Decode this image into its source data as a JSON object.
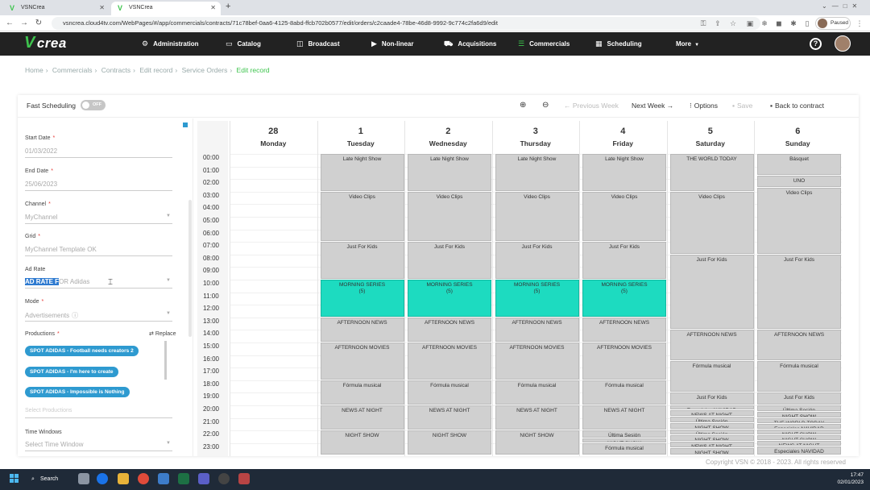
{
  "browser": {
    "tabs": [
      {
        "title": "VSNCrea"
      },
      {
        "title": "VSNCrea"
      }
    ],
    "url": "vsncrea.cloud4tv.com/WebPages/#/app/commercials/contracts/71c78bef-0aa6-4125-8abd-ffcb702b0577/edit/orders/c2caade4-78be-46d8-9992-9c774c2fa6d9/edit",
    "profile_status": "Paused"
  },
  "app": {
    "logo": "crea",
    "nav": [
      {
        "label": "Administration",
        "icon": "gear-icon"
      },
      {
        "label": "Catalog",
        "icon": "folder-icon"
      },
      {
        "label": "Broadcast",
        "icon": "broadcast-icon"
      },
      {
        "label": "Non-linear",
        "icon": "play-icon"
      },
      {
        "label": "Acquisitions",
        "icon": "basket-icon"
      },
      {
        "label": "Commercials",
        "icon": "list-icon"
      },
      {
        "label": "Scheduling",
        "icon": "calendar-icon"
      },
      {
        "label": "More",
        "icon": "caret-down-icon"
      }
    ],
    "active_nav": "Commercials",
    "accent_color": "#3ec44e"
  },
  "breadcrumb": [
    "Home",
    "Commercials",
    "Contracts",
    "Edit record",
    "Service Orders",
    "Edit record"
  ],
  "toolbar": {
    "fast_scheduling_label": "Fast Scheduling",
    "fast_scheduling_state": "OFF",
    "previous_week": "← Previous Week",
    "next_week": "Next Week →",
    "options": "Options",
    "save": "Save",
    "back": "Back to contract"
  },
  "form": {
    "start_date": {
      "label": "Start Date",
      "value": "01/03/2022"
    },
    "end_date": {
      "label": "End Date",
      "value": "25/06/2023"
    },
    "channel": {
      "label": "Channel",
      "value": "MyChannel"
    },
    "grid": {
      "label": "Grid",
      "value": "MyChannel Template OK"
    },
    "ad_rate": {
      "label": "Ad Rate",
      "value_selected": "AD RATE F",
      "value_rest": "OR Adidas"
    },
    "mode": {
      "label": "Mode",
      "value": "Advertisements"
    },
    "productions": {
      "label": "Productions",
      "replace_label": "Replace",
      "items": [
        "SPOT ADIDAS - Football needs creators 2",
        "SPOT ADIDAS - I'm here to create",
        "SPOT ADIDAS - Impossible is Nothing"
      ],
      "placeholder": "Select Productions"
    },
    "time_windows": {
      "label": "Time Windows",
      "placeholder": "Select Time Window"
    }
  },
  "schedule": {
    "hours": [
      "00:00",
      "01:00",
      "02:00",
      "03:00",
      "04:00",
      "05:00",
      "06:00",
      "07:00",
      "08:00",
      "09:00",
      "10:00",
      "11:00",
      "12:00",
      "13:00",
      "14:00",
      "15:00",
      "16:00",
      "17:00",
      "18:00",
      "19:00",
      "20:00",
      "21:00",
      "22:00",
      "23:00"
    ],
    "days": [
      {
        "num": "28",
        "name": "Monday",
        "blocks": []
      },
      {
        "num": "1",
        "name": "Tuesday",
        "blocks": [
          {
            "label": "Late Night Show",
            "start": 0,
            "end": 3
          },
          {
            "label": "Video Clips",
            "start": 3,
            "end": 7
          },
          {
            "label": "Just For Kids",
            "start": 7,
            "end": 10
          },
          {
            "label": "MORNING SERIES",
            "sub": "(5)",
            "start": 10,
            "end": 13,
            "teal": true
          },
          {
            "label": "AFTERNOON NEWS",
            "start": 13,
            "end": 15
          },
          {
            "label": "AFTERNOON MOVIES",
            "start": 15,
            "end": 18
          },
          {
            "label": "Fórmula musical",
            "start": 18,
            "end": 20
          },
          {
            "label": "NEWS AT NIGHT",
            "start": 20,
            "end": 22
          },
          {
            "label": "NIGHT SHOW",
            "start": 22,
            "end": 24
          }
        ]
      },
      {
        "num": "2",
        "name": "Wednesday",
        "blocks": [
          {
            "label": "Late Night Show",
            "start": 0,
            "end": 3
          },
          {
            "label": "Video Clips",
            "start": 3,
            "end": 7
          },
          {
            "label": "Just For Kids",
            "start": 7,
            "end": 10
          },
          {
            "label": "MORNING SERIES",
            "sub": "(5)",
            "start": 10,
            "end": 13,
            "teal": true
          },
          {
            "label": "AFTERNOON NEWS",
            "start": 13,
            "end": 15
          },
          {
            "label": "AFTERNOON MOVIES",
            "start": 15,
            "end": 18
          },
          {
            "label": "Fórmula musical",
            "start": 18,
            "end": 20
          },
          {
            "label": "NEWS AT NIGHT",
            "start": 20,
            "end": 22
          },
          {
            "label": "NIGHT SHOW",
            "start": 22,
            "end": 24
          }
        ]
      },
      {
        "num": "3",
        "name": "Thursday",
        "blocks": [
          {
            "label": "Late Night Show",
            "start": 0,
            "end": 3
          },
          {
            "label": "Video Clips",
            "start": 3,
            "end": 7
          },
          {
            "label": "Just For Kids",
            "start": 7,
            "end": 10
          },
          {
            "label": "MORNING SERIES",
            "sub": "(5)",
            "start": 10,
            "end": 13,
            "teal": true
          },
          {
            "label": "AFTERNOON NEWS",
            "start": 13,
            "end": 15
          },
          {
            "label": "AFTERNOON MOVIES",
            "start": 15,
            "end": 18
          },
          {
            "label": "Fórmula musical",
            "start": 18,
            "end": 20
          },
          {
            "label": "NEWS AT NIGHT",
            "start": 20,
            "end": 22
          },
          {
            "label": "NIGHT SHOW",
            "start": 22,
            "end": 24
          }
        ]
      },
      {
        "num": "4",
        "name": "Friday",
        "blocks": [
          {
            "label": "Late Night Show",
            "start": 0,
            "end": 3
          },
          {
            "label": "Video Clips",
            "start": 3,
            "end": 7
          },
          {
            "label": "Just For Kids",
            "start": 7,
            "end": 10
          },
          {
            "label": "MORNING SERIES",
            "sub": "(5)",
            "start": 10,
            "end": 13,
            "teal": true
          },
          {
            "label": "AFTERNOON NEWS",
            "start": 13,
            "end": 15
          },
          {
            "label": "AFTERNOON MOVIES",
            "start": 15,
            "end": 18
          },
          {
            "label": "Fórmula musical",
            "start": 18,
            "end": 20
          },
          {
            "label": "NEWS AT NIGHT",
            "start": 20,
            "end": 22
          },
          {
            "label": "Última Sesión",
            "start": 22,
            "end": 22.6
          },
          {
            "label": "NIGHT SHOW",
            "start": 22.6,
            "end": 23
          },
          {
            "label": "Fórmula musical",
            "start": 23,
            "end": 24
          }
        ]
      },
      {
        "num": "5",
        "name": "Saturday",
        "blocks": [
          {
            "label": "THE WORLD TODAY",
            "start": 0,
            "end": 3
          },
          {
            "label": "Video Clips",
            "start": 3,
            "end": 8
          },
          {
            "label": "Just For Kids",
            "start": 8,
            "end": 14
          },
          {
            "label": "AFTERNOON NEWS",
            "start": 14,
            "end": 16.5
          },
          {
            "label": "Fórmula musical",
            "start": 16.5,
            "end": 19
          },
          {
            "label": "Just For Kids",
            "start": 19,
            "end": 20
          },
          {
            "label": "Especiales NAVIDAD",
            "start": 20,
            "end": 20.4
          },
          {
            "label": "NEWS AT NIGHT",
            "start": 20.4,
            "end": 20.9
          },
          {
            "label": "Última Sesión",
            "start": 20.9,
            "end": 21.4
          },
          {
            "label": "NIGHT SHOW",
            "start": 21.4,
            "end": 21.9
          },
          {
            "label": "Última Sesión",
            "start": 21.9,
            "end": 22.4
          },
          {
            "label": "NIGHT SHOW",
            "start": 22.4,
            "end": 22.9
          },
          {
            "label": "NEWS AT NIGHT",
            "start": 22.9,
            "end": 23.4
          },
          {
            "label": "NIGHT SHOW",
            "start": 23.4,
            "end": 24
          }
        ]
      },
      {
        "num": "6",
        "name": "Sunday",
        "blocks": [
          {
            "label": "Básquet",
            "start": 0,
            "end": 1.7
          },
          {
            "label": "UNO",
            "start": 1.7,
            "end": 2.7
          },
          {
            "label": "Video Clips",
            "start": 2.7,
            "end": 8
          },
          {
            "label": "Just For Kids",
            "start": 8,
            "end": 14
          },
          {
            "label": "AFTERNOON NEWS",
            "start": 14,
            "end": 16.5
          },
          {
            "label": "Fórmula musical",
            "start": 16.5,
            "end": 19
          },
          {
            "label": "Just For Kids",
            "start": 19,
            "end": 20
          },
          {
            "label": "Última Sesión",
            "start": 20,
            "end": 20.5
          },
          {
            "label": "NIGHT SHOW",
            "start": 20.5,
            "end": 21
          },
          {
            "label": "THE WORLD TODAY",
            "start": 21,
            "end": 21.5
          },
          {
            "label": "Especiales NAVIDAD",
            "start": 21.5,
            "end": 21.9
          },
          {
            "label": "NIGHT SHOW",
            "start": 21.9,
            "end": 22.4
          },
          {
            "label": "NIGHT SHOW",
            "start": 22.4,
            "end": 22.8
          },
          {
            "label": "NEWS AT NIGHT",
            "start": 22.8,
            "end": 23.3
          },
          {
            "label": "Especiales NAVIDAD",
            "start": 23.3,
            "end": 24
          }
        ]
      }
    ]
  },
  "footer": {
    "copyright": "Copyright VSN © 2018 - 2023. All rights reserved"
  },
  "taskbar": {
    "search_label": "Search",
    "time": "17:47",
    "date": "02/01/2023"
  }
}
